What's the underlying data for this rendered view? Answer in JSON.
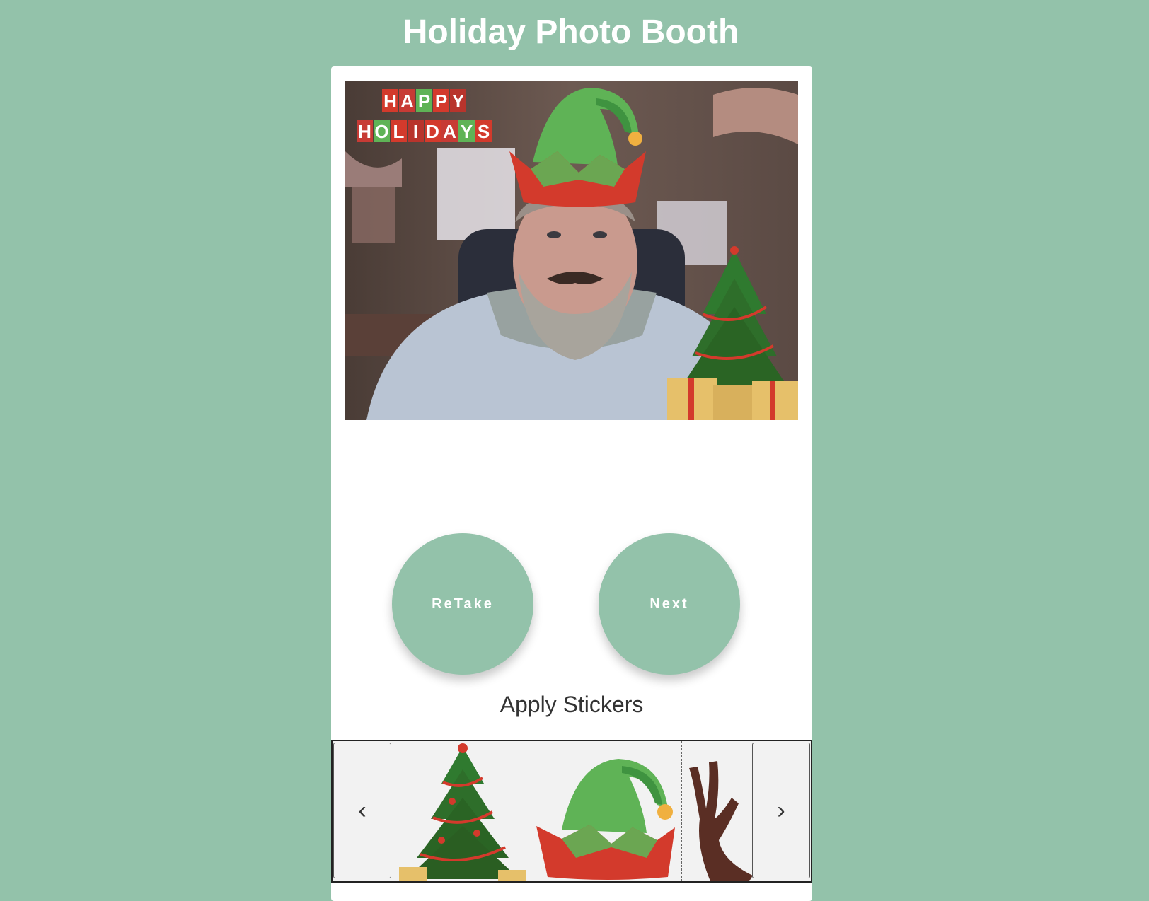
{
  "header": {
    "title": "Holiday Photo Booth"
  },
  "photo": {
    "banner_line1": [
      "H",
      "A",
      "P",
      "P",
      "Y"
    ],
    "banner_line2": [
      "H",
      "O",
      "L",
      "I",
      "D",
      "A",
      "Y",
      "S"
    ]
  },
  "actions": {
    "retake_label": "ReTake",
    "next_label": "Next"
  },
  "stickers": {
    "heading": "Apply Stickers",
    "items": [
      "christmas-tree",
      "elf-hat",
      "reindeer-antler"
    ],
    "prev_icon": "chevron-left-icon",
    "next_icon": "chevron-right-icon"
  },
  "colors": {
    "background": "#93c2aa",
    "button": "#93c2aa",
    "card": "#ffffff",
    "hat_green": "#5fb356",
    "hat_red": "#d33a2c"
  }
}
